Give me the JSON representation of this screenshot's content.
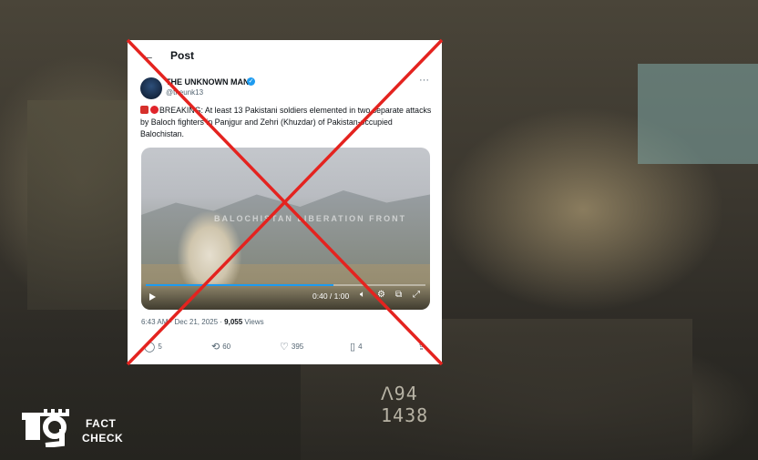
{
  "post_header": {
    "title": "Post",
    "back_icon": "arrow-left-icon"
  },
  "author": {
    "name": "THE UNKNOWN MAN",
    "handle": "@theunk13",
    "verified_color": "#1d9bf0"
  },
  "tweet": {
    "text": "BREAKING: At least 13 Pakistani soldiers elemented in two separate attacks by Baloch fighters in Panjgur and Zehri (Khuzdar) of Pakistan-occupied Balochistan."
  },
  "video": {
    "watermark": "BALOCHISTAN LIBERATION FRONT",
    "time": "0:40 / 1:00",
    "progress": 0.67
  },
  "meta": {
    "timestamp": "6:43 AM · Dec 21, 2025 · ",
    "views_count": "9,055",
    "views_label": " Views"
  },
  "actions": {
    "replies": "5",
    "reposts": "60",
    "likes": "395",
    "bookmarks": "4"
  },
  "background": {
    "plate_text": "ᐱ94 1438"
  },
  "logo": {
    "fact": "FACT",
    "check": "CHECK"
  },
  "colors": {
    "cross": "#e4231f",
    "accent": "#1d9bf0"
  }
}
